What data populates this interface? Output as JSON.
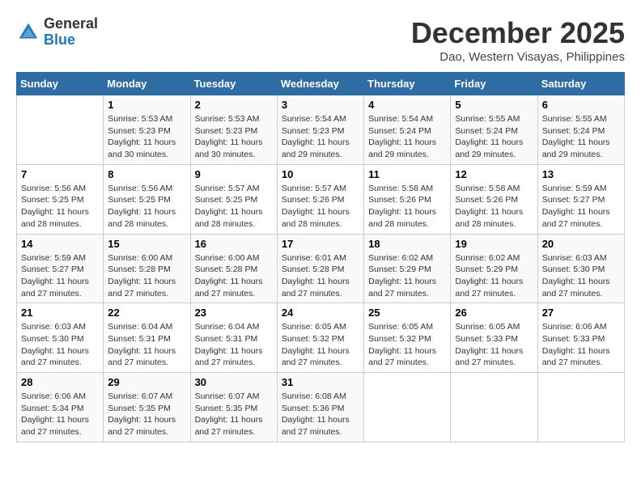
{
  "logo": {
    "general": "General",
    "blue": "Blue"
  },
  "title": "December 2025",
  "location": "Dao, Western Visayas, Philippines",
  "days_of_week": [
    "Sunday",
    "Monday",
    "Tuesday",
    "Wednesday",
    "Thursday",
    "Friday",
    "Saturday"
  ],
  "weeks": [
    [
      {
        "num": "",
        "detail": ""
      },
      {
        "num": "1",
        "detail": "Sunrise: 5:53 AM\nSunset: 5:23 PM\nDaylight: 11 hours\nand 30 minutes."
      },
      {
        "num": "2",
        "detail": "Sunrise: 5:53 AM\nSunset: 5:23 PM\nDaylight: 11 hours\nand 30 minutes."
      },
      {
        "num": "3",
        "detail": "Sunrise: 5:54 AM\nSunset: 5:23 PM\nDaylight: 11 hours\nand 29 minutes."
      },
      {
        "num": "4",
        "detail": "Sunrise: 5:54 AM\nSunset: 5:24 PM\nDaylight: 11 hours\nand 29 minutes."
      },
      {
        "num": "5",
        "detail": "Sunrise: 5:55 AM\nSunset: 5:24 PM\nDaylight: 11 hours\nand 29 minutes."
      },
      {
        "num": "6",
        "detail": "Sunrise: 5:55 AM\nSunset: 5:24 PM\nDaylight: 11 hours\nand 29 minutes."
      }
    ],
    [
      {
        "num": "7",
        "detail": "Sunrise: 5:56 AM\nSunset: 5:25 PM\nDaylight: 11 hours\nand 28 minutes."
      },
      {
        "num": "8",
        "detail": "Sunrise: 5:56 AM\nSunset: 5:25 PM\nDaylight: 11 hours\nand 28 minutes."
      },
      {
        "num": "9",
        "detail": "Sunrise: 5:57 AM\nSunset: 5:25 PM\nDaylight: 11 hours\nand 28 minutes."
      },
      {
        "num": "10",
        "detail": "Sunrise: 5:57 AM\nSunset: 5:26 PM\nDaylight: 11 hours\nand 28 minutes."
      },
      {
        "num": "11",
        "detail": "Sunrise: 5:58 AM\nSunset: 5:26 PM\nDaylight: 11 hours\nand 28 minutes."
      },
      {
        "num": "12",
        "detail": "Sunrise: 5:58 AM\nSunset: 5:26 PM\nDaylight: 11 hours\nand 28 minutes."
      },
      {
        "num": "13",
        "detail": "Sunrise: 5:59 AM\nSunset: 5:27 PM\nDaylight: 11 hours\nand 27 minutes."
      }
    ],
    [
      {
        "num": "14",
        "detail": "Sunrise: 5:59 AM\nSunset: 5:27 PM\nDaylight: 11 hours\nand 27 minutes."
      },
      {
        "num": "15",
        "detail": "Sunrise: 6:00 AM\nSunset: 5:28 PM\nDaylight: 11 hours\nand 27 minutes."
      },
      {
        "num": "16",
        "detail": "Sunrise: 6:00 AM\nSunset: 5:28 PM\nDaylight: 11 hours\nand 27 minutes."
      },
      {
        "num": "17",
        "detail": "Sunrise: 6:01 AM\nSunset: 5:28 PM\nDaylight: 11 hours\nand 27 minutes."
      },
      {
        "num": "18",
        "detail": "Sunrise: 6:02 AM\nSunset: 5:29 PM\nDaylight: 11 hours\nand 27 minutes."
      },
      {
        "num": "19",
        "detail": "Sunrise: 6:02 AM\nSunset: 5:29 PM\nDaylight: 11 hours\nand 27 minutes."
      },
      {
        "num": "20",
        "detail": "Sunrise: 6:03 AM\nSunset: 5:30 PM\nDaylight: 11 hours\nand 27 minutes."
      }
    ],
    [
      {
        "num": "21",
        "detail": "Sunrise: 6:03 AM\nSunset: 5:30 PM\nDaylight: 11 hours\nand 27 minutes."
      },
      {
        "num": "22",
        "detail": "Sunrise: 6:04 AM\nSunset: 5:31 PM\nDaylight: 11 hours\nand 27 minutes."
      },
      {
        "num": "23",
        "detail": "Sunrise: 6:04 AM\nSunset: 5:31 PM\nDaylight: 11 hours\nand 27 minutes."
      },
      {
        "num": "24",
        "detail": "Sunrise: 6:05 AM\nSunset: 5:32 PM\nDaylight: 11 hours\nand 27 minutes."
      },
      {
        "num": "25",
        "detail": "Sunrise: 6:05 AM\nSunset: 5:32 PM\nDaylight: 11 hours\nand 27 minutes."
      },
      {
        "num": "26",
        "detail": "Sunrise: 6:05 AM\nSunset: 5:33 PM\nDaylight: 11 hours\nand 27 minutes."
      },
      {
        "num": "27",
        "detail": "Sunrise: 6:06 AM\nSunset: 5:33 PM\nDaylight: 11 hours\nand 27 minutes."
      }
    ],
    [
      {
        "num": "28",
        "detail": "Sunrise: 6:06 AM\nSunset: 5:34 PM\nDaylight: 11 hours\nand 27 minutes."
      },
      {
        "num": "29",
        "detail": "Sunrise: 6:07 AM\nSunset: 5:35 PM\nDaylight: 11 hours\nand 27 minutes."
      },
      {
        "num": "30",
        "detail": "Sunrise: 6:07 AM\nSunset: 5:35 PM\nDaylight: 11 hours\nand 27 minutes."
      },
      {
        "num": "31",
        "detail": "Sunrise: 6:08 AM\nSunset: 5:36 PM\nDaylight: 11 hours\nand 27 minutes."
      },
      {
        "num": "",
        "detail": ""
      },
      {
        "num": "",
        "detail": ""
      },
      {
        "num": "",
        "detail": ""
      }
    ]
  ]
}
